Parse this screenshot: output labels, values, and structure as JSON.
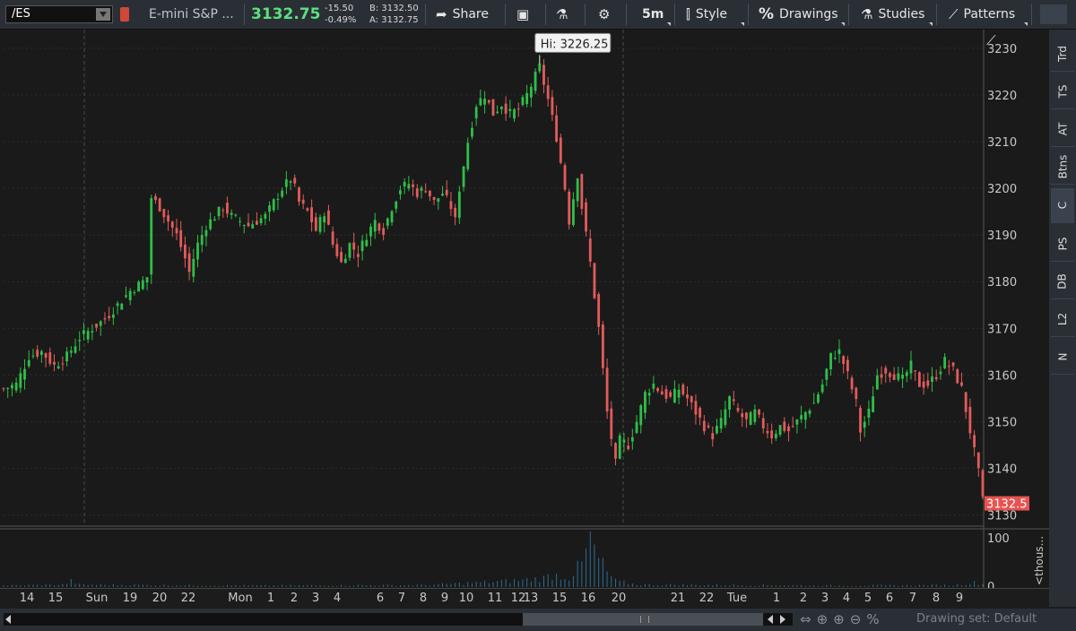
{
  "toolbar": {
    "symbol": "/ES",
    "description": "E-mini S&P ...",
    "last_price": "3132.75",
    "change": "-15.50",
    "change_pct": "-0.49%",
    "bid": "B: 3132.50",
    "ask": "A: 3132.75",
    "share_label": "Share",
    "timeframe_label": "5m",
    "style_label": "Style",
    "drawings_label": "Drawings",
    "studies_label": "Studies",
    "patterns_label": "Patterns",
    "icons": [
      "share-icon",
      "snapshot-icon",
      "flask-icon",
      "gear-icon",
      "candle-style-icon",
      "percent-icon",
      "flask-icon",
      "patterns-icon"
    ]
  },
  "right_tabs": [
    "Trd",
    "TS",
    "AT",
    "Btns",
    "C",
    "PS",
    "DB",
    "L2",
    "N"
  ],
  "bottom": {
    "drawing_set": "Drawing set: Default"
  },
  "colors": {
    "up": "#2fbf4a",
    "down": "#e35b5b",
    "last_price_tag": "#e8534f",
    "volume": "#2b6e96",
    "background": "#1c1c1c"
  },
  "chart_data": {
    "type": "candlestick",
    "y_ticks": [
      3130,
      3140,
      3150,
      3160,
      3170,
      3180,
      3190,
      3200,
      3210,
      3220,
      3230
    ],
    "ylim": [
      3128,
      3234
    ],
    "x_ticks": [
      "14",
      "15",
      "Sun",
      "19",
      "20",
      "22",
      "Mon",
      "1",
      "2",
      "3",
      "4",
      "6",
      "7",
      "8",
      "9",
      "10",
      "11",
      "12",
      "13",
      "15",
      "16",
      "20",
      "21",
      "22",
      "Tue",
      "1",
      "2",
      "3",
      "4",
      "5",
      "6",
      "7",
      "8",
      "9"
    ],
    "session_breaks": [
      "Sun",
      "16"
    ],
    "annotation": "Hi: 3226.25",
    "last_price_label": "3132.5",
    "volume_ticks": [
      "100",
      "0"
    ],
    "volume_axis_label": "<thous...",
    "price_path": [
      [
        0,
        3157
      ],
      [
        3,
        3158
      ],
      [
        6,
        3164
      ],
      [
        9,
        3165
      ],
      [
        12,
        3162
      ],
      [
        15,
        3164
      ],
      [
        18,
        3168
      ],
      [
        21,
        3170
      ],
      [
        24,
        3172
      ],
      [
        27,
        3175
      ],
      [
        30,
        3178
      ],
      [
        33,
        3180
      ],
      [
        34,
        3181
      ],
      [
        35,
        3198
      ],
      [
        37,
        3196
      ],
      [
        39,
        3193
      ],
      [
        41,
        3190
      ],
      [
        43,
        3185
      ],
      [
        44,
        3182
      ],
      [
        46,
        3188
      ],
      [
        48,
        3192
      ],
      [
        50,
        3194
      ],
      [
        52,
        3196
      ],
      [
        54,
        3194
      ],
      [
        56,
        3193
      ],
      [
        58,
        3192
      ],
      [
        60,
        3193
      ],
      [
        62,
        3194
      ],
      [
        64,
        3197
      ],
      [
        66,
        3200
      ],
      [
        68,
        3202
      ],
      [
        69,
        3200
      ],
      [
        70,
        3197
      ],
      [
        72,
        3195
      ],
      [
        74,
        3191
      ],
      [
        76,
        3195
      ],
      [
        78,
        3188
      ],
      [
        80,
        3184
      ],
      [
        82,
        3188
      ],
      [
        84,
        3186
      ],
      [
        86,
        3190
      ],
      [
        88,
        3193
      ],
      [
        90,
        3191
      ],
      [
        92,
        3196
      ],
      [
        94,
        3200
      ],
      [
        96,
        3201
      ],
      [
        98,
        3199
      ],
      [
        100,
        3200
      ],
      [
        102,
        3197
      ],
      [
        104,
        3199
      ],
      [
        106,
        3196
      ],
      [
        107,
        3193
      ],
      [
        108,
        3200
      ],
      [
        110,
        3210
      ],
      [
        112,
        3218
      ],
      [
        114,
        3220
      ],
      [
        116,
        3216
      ],
      [
        118,
        3218
      ],
      [
        120,
        3216
      ],
      [
        122,
        3217
      ],
      [
        124,
        3220
      ],
      [
        126,
        3224
      ],
      [
        127,
        3226
      ],
      [
        129,
        3219
      ],
      [
        131,
        3211
      ],
      [
        133,
        3200
      ],
      [
        134,
        3193
      ],
      [
        136,
        3203
      ],
      [
        137,
        3196
      ],
      [
        139,
        3184
      ],
      [
        141,
        3170
      ],
      [
        143,
        3152
      ],
      [
        145,
        3141
      ],
      [
        146,
        3146
      ],
      [
        148,
        3145
      ],
      [
        150,
        3150
      ],
      [
        152,
        3156
      ],
      [
        154,
        3158
      ],
      [
        156,
        3156
      ],
      [
        158,
        3155
      ],
      [
        160,
        3157
      ],
      [
        162,
        3155
      ],
      [
        164,
        3152
      ],
      [
        166,
        3149
      ],
      [
        168,
        3147
      ],
      [
        170,
        3150
      ],
      [
        172,
        3155
      ],
      [
        174,
        3152
      ],
      [
        176,
        3150
      ],
      [
        178,
        3152
      ],
      [
        180,
        3149
      ],
      [
        182,
        3147
      ],
      [
        184,
        3149
      ],
      [
        186,
        3148
      ],
      [
        188,
        3150
      ],
      [
        190,
        3152
      ],
      [
        192,
        3154
      ],
      [
        194,
        3158
      ],
      [
        196,
        3164
      ],
      [
        198,
        3165
      ],
      [
        200,
        3160
      ],
      [
        202,
        3154
      ],
      [
        203,
        3148
      ],
      [
        205,
        3152
      ],
      [
        207,
        3160
      ],
      [
        209,
        3161
      ],
      [
        211,
        3160
      ],
      [
        213,
        3159
      ],
      [
        215,
        3162
      ],
      [
        217,
        3158
      ],
      [
        219,
        3158
      ],
      [
        221,
        3160
      ],
      [
        223,
        3163
      ],
      [
        225,
        3161
      ],
      [
        227,
        3157
      ],
      [
        229,
        3148
      ],
      [
        231,
        3139
      ],
      [
        232,
        3133
      ]
    ],
    "x_count": 233,
    "volume_path": [
      [
        0,
        3
      ],
      [
        14,
        5
      ],
      [
        16,
        12
      ],
      [
        18,
        5
      ],
      [
        34,
        4
      ],
      [
        60,
        3
      ],
      [
        100,
        4
      ],
      [
        110,
        8
      ],
      [
        115,
        10
      ],
      [
        120,
        12
      ],
      [
        128,
        18
      ],
      [
        130,
        25
      ],
      [
        134,
        20
      ],
      [
        137,
        45
      ],
      [
        139,
        95
      ],
      [
        141,
        55
      ],
      [
        143,
        30
      ],
      [
        145,
        12
      ],
      [
        150,
        5
      ],
      [
        200,
        3
      ],
      [
        225,
        4
      ],
      [
        230,
        9
      ],
      [
        232,
        6
      ]
    ]
  }
}
